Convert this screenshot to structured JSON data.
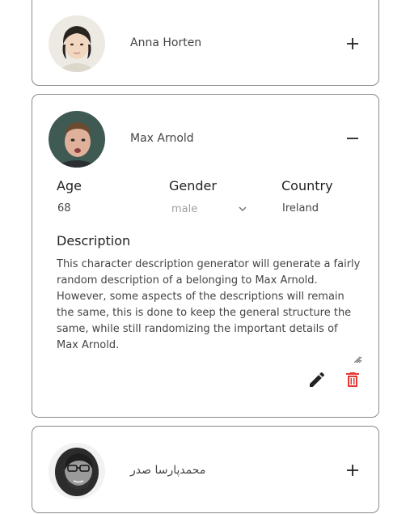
{
  "users": [
    {
      "name": "Anna Horten",
      "expanded": false,
      "toggle_icon": "plus-icon"
    },
    {
      "name": "Max Arnold",
      "expanded": true,
      "toggle_icon": "minus-icon",
      "details": {
        "age_label": "Age",
        "age_value": "68",
        "gender_label": "Gender",
        "gender_value": "male",
        "country_label": "Country",
        "country_value": "Ireland",
        "description_label": "Description",
        "description": "This character description generator will generate a fairly random description of a belonging to Max Arnold. However, some aspects of the descriptions will remain the same, this is done to keep the general structure the same, while still randomizing the important details of Max Arnold."
      },
      "actions": {
        "edit_icon": "pencil-icon",
        "delete_icon": "trash-icon"
      }
    },
    {
      "name": "محمدپارسا صدر",
      "expanded": false,
      "toggle_icon": "plus-icon"
    }
  ],
  "colors": {
    "border": "#8a8a8a",
    "text": "#444444",
    "label": "#222222",
    "muted": "#a0a0a0",
    "delete": "#e53935"
  }
}
